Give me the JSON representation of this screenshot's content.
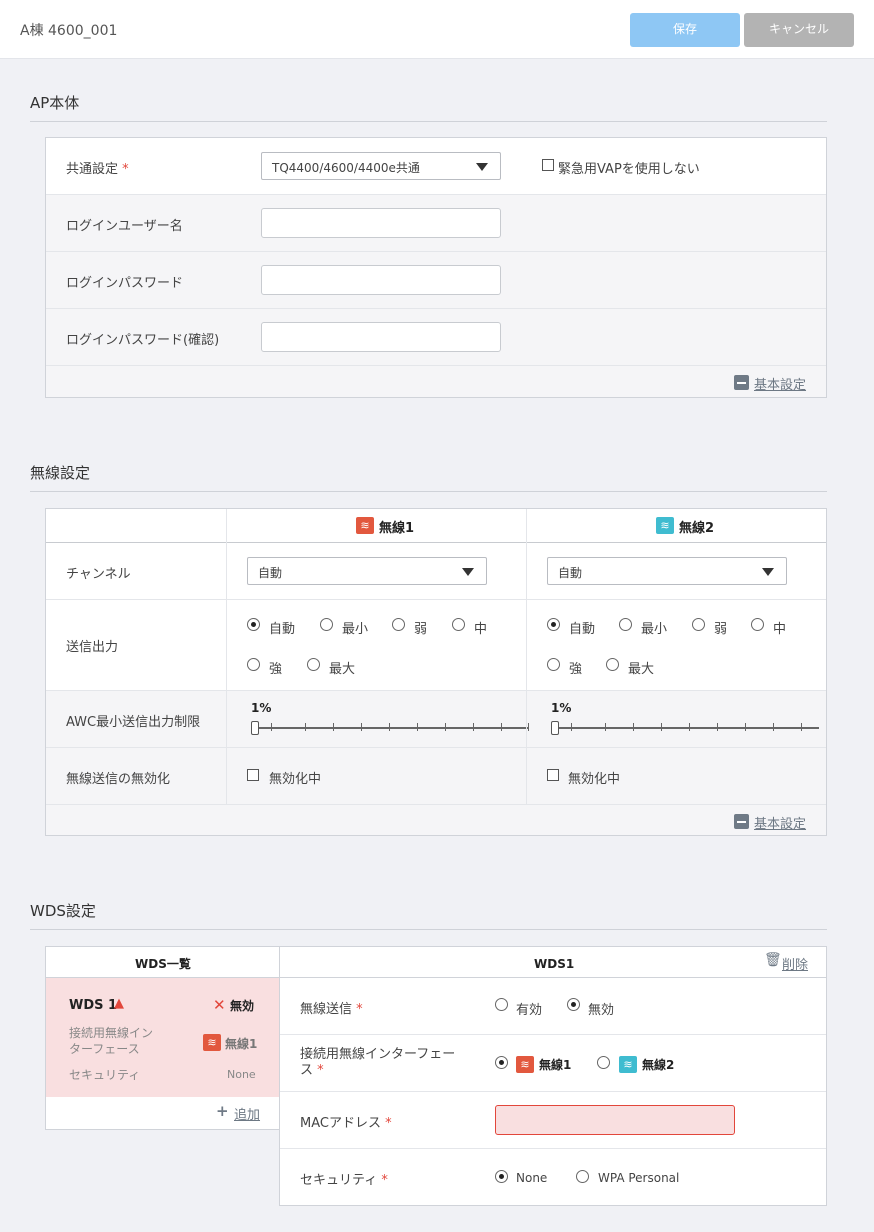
{
  "header": {
    "title": "A棟 4600_001",
    "save_label": "保存",
    "cancel_label": "キャンセル"
  },
  "ap_section": {
    "title": "AP本体",
    "common_label": "共通設定",
    "common_value": "TQ4400/4600/4400e共通",
    "emergency_vap_label": "緊急用VAPを使用しない",
    "login_user_label": "ログインユーザー名",
    "login_password_label": "ログインパスワード",
    "login_password_confirm_label": "ログインパスワード(確認)",
    "basic_settings_link": "基本設定"
  },
  "wireless_section": {
    "title": "無線設定",
    "radio1_label": "無線1",
    "radio2_label": "無線2",
    "channel_label": "チャンネル",
    "channel1_value": "自動",
    "channel2_value": "自動",
    "tx_power_label": "送信出力",
    "tx_options": [
      "自動",
      "最小",
      "弱",
      "中",
      "強",
      "最大"
    ],
    "tx_selected_1": "自動",
    "tx_selected_2": "自動",
    "awc_label": "AWC最小送信出力制限",
    "awc1_value": "1%",
    "awc2_value": "1%",
    "disable_label": "無線送信の無効化",
    "disable_option": "無効化中",
    "basic_settings_link": "基本設定"
  },
  "wds_section": {
    "title": "WDS設定",
    "list_header": "WDS一覧",
    "item": {
      "name": "WDS 1",
      "status": "無効",
      "iface_label": "接続用無線インターフェース",
      "iface_value": "無線1",
      "security_label": "セキュリティ",
      "security_value": "None"
    },
    "add_label": "追加",
    "detail_header": "WDS1",
    "delete_label": "削除",
    "wireless_tx_label": "無線送信",
    "tx_enable": "有効",
    "tx_disable": "無効",
    "iface_label": "接続用無線インターフェース",
    "iface_opt1": "無線1",
    "iface_opt2": "無線2",
    "mac_label": "MACアドレス",
    "security_label": "セキュリティ",
    "security_none": "None",
    "security_wpa": "WPA Personal"
  },
  "colors": {
    "accent": "#8ec7f4",
    "error_bg": "#f9dfe0",
    "required": "#e2463b",
    "radio1": "#e2583e",
    "radio2": "#3fbcd0"
  }
}
